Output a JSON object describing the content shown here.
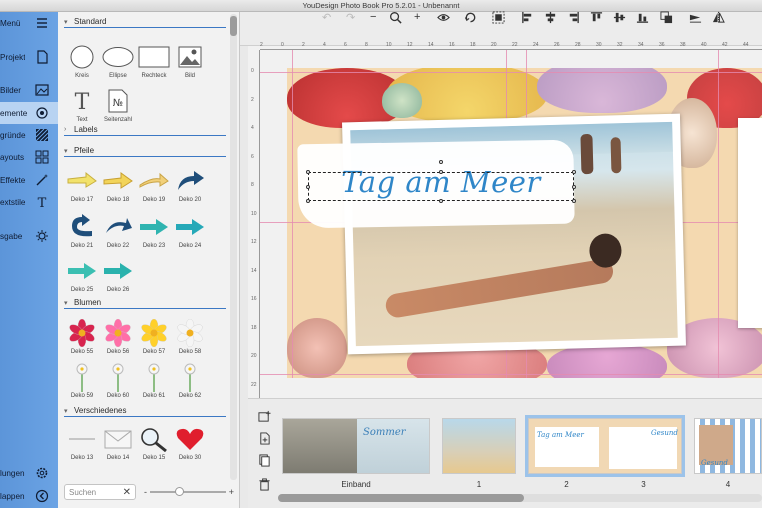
{
  "app": {
    "title": "YouDesign Photo Book Pro 5.2.01 - Unbenannt"
  },
  "sidebar": {
    "items": [
      {
        "label": "Menü",
        "icon": "menu-icon"
      },
      {
        "label": "Projekt",
        "icon": "document-icon"
      },
      {
        "label": "Bilder",
        "icon": "image-icon"
      },
      {
        "label": "ementе",
        "icon": "elements-icon"
      },
      {
        "label": "gründe",
        "icon": "backgrounds-icon"
      },
      {
        "label": "ayouts",
        "icon": "layouts-icon"
      },
      {
        "label": "Effekte",
        "icon": "magic-wand-icon"
      },
      {
        "label": "extstile",
        "icon": "text-style-icon"
      },
      {
        "label": "sgabe",
        "icon": "output-icon"
      },
      {
        "label": "lungen",
        "icon": "settings-icon"
      },
      {
        "label": "lappen",
        "icon": "collapse-icon"
      }
    ]
  },
  "panel": {
    "sections": {
      "standard": "Standard",
      "labels": "Labels",
      "pfeile": "Pfeile",
      "blumen": "Blumen",
      "verschiedenes": "Verschiedenes"
    },
    "standard_items": [
      "Kreis",
      "Ellipse",
      "Rechteck",
      "Bild",
      "Text",
      "Seitenzahl"
    ],
    "pfeile_items": [
      "Deko 17",
      "Deko 18",
      "Deko 19",
      "Deko 20",
      "Deko 21",
      "Deko 22",
      "Deko 23",
      "Deko 24",
      "Deko 25",
      "Deko 26"
    ],
    "blumen_items": [
      "Deko 55",
      "Deko 56",
      "Deko 57",
      "Deko 58",
      "Deko 59",
      "Deko 60",
      "Deko 61",
      "Deko 62"
    ],
    "verschiedenes_items": [
      "Deko 13",
      "Deko 14",
      "Deko 15",
      "Deko 30"
    ],
    "search_placeholder": "Suchen",
    "zoom_minus": "-",
    "zoom_plus": "+",
    "zoom_level": 0.38
  },
  "toolbar": {
    "undo": "↶",
    "redo": "↷",
    "zoom_out": "−",
    "zoom_in": "+"
  },
  "ruler": {
    "top": [
      "2",
      "0",
      "2",
      "4",
      "6",
      "8",
      "10",
      "12",
      "14",
      "16",
      "18",
      "20",
      "22",
      "24",
      "26",
      "28",
      "30",
      "32",
      "34",
      "36",
      "38",
      "40",
      "42",
      "44",
      "46"
    ],
    "left": [
      "0",
      "2",
      "4",
      "6",
      "8",
      "10",
      "12",
      "14",
      "16",
      "18",
      "20",
      "22"
    ]
  },
  "canvas": {
    "headline": "Tag am Meer"
  },
  "thumbnails": [
    {
      "label": "Einband"
    },
    {
      "label": "1"
    },
    {
      "label": "2"
    },
    {
      "label": "3"
    },
    {
      "label": "4"
    }
  ],
  "thumb_text": {
    "cover": "Sommer",
    "spread_a": "Tag am Meer",
    "spread_b": "Gesund",
    "spread_c": "Gesund"
  },
  "colors": {
    "sidebar_blue": "#6ba3e4",
    "accent": "#2f86c8",
    "selection": "#9cc3ea"
  }
}
